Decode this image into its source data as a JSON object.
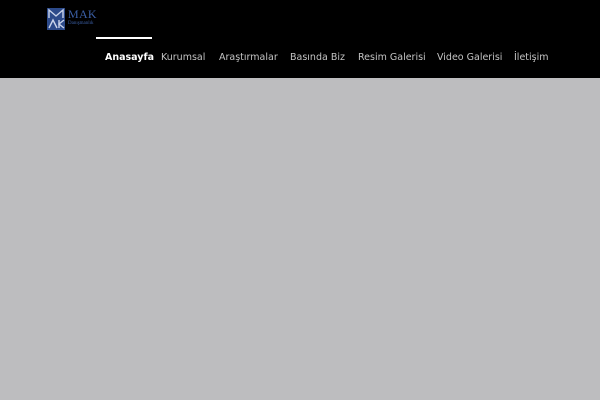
{
  "brand": {
    "name": "MAK",
    "tagline": "Danışmanlık",
    "color": "#3b5fa5"
  },
  "nav": {
    "items": [
      {
        "label": "Anasayfa",
        "active": true
      },
      {
        "label": "Kurumsal",
        "active": false
      },
      {
        "label": "Araştırmalar",
        "active": false
      },
      {
        "label": "Basında Biz",
        "active": false
      },
      {
        "label": "Resim Galerisi",
        "active": false
      },
      {
        "label": "Video Galerisi",
        "active": false
      },
      {
        "label": "İletişim",
        "active": false
      }
    ]
  },
  "colors": {
    "header_background": "#000000",
    "content_background": "#bdbdbf",
    "nav_text": "#c4c4c4",
    "nav_active_text": "#ffffff"
  }
}
